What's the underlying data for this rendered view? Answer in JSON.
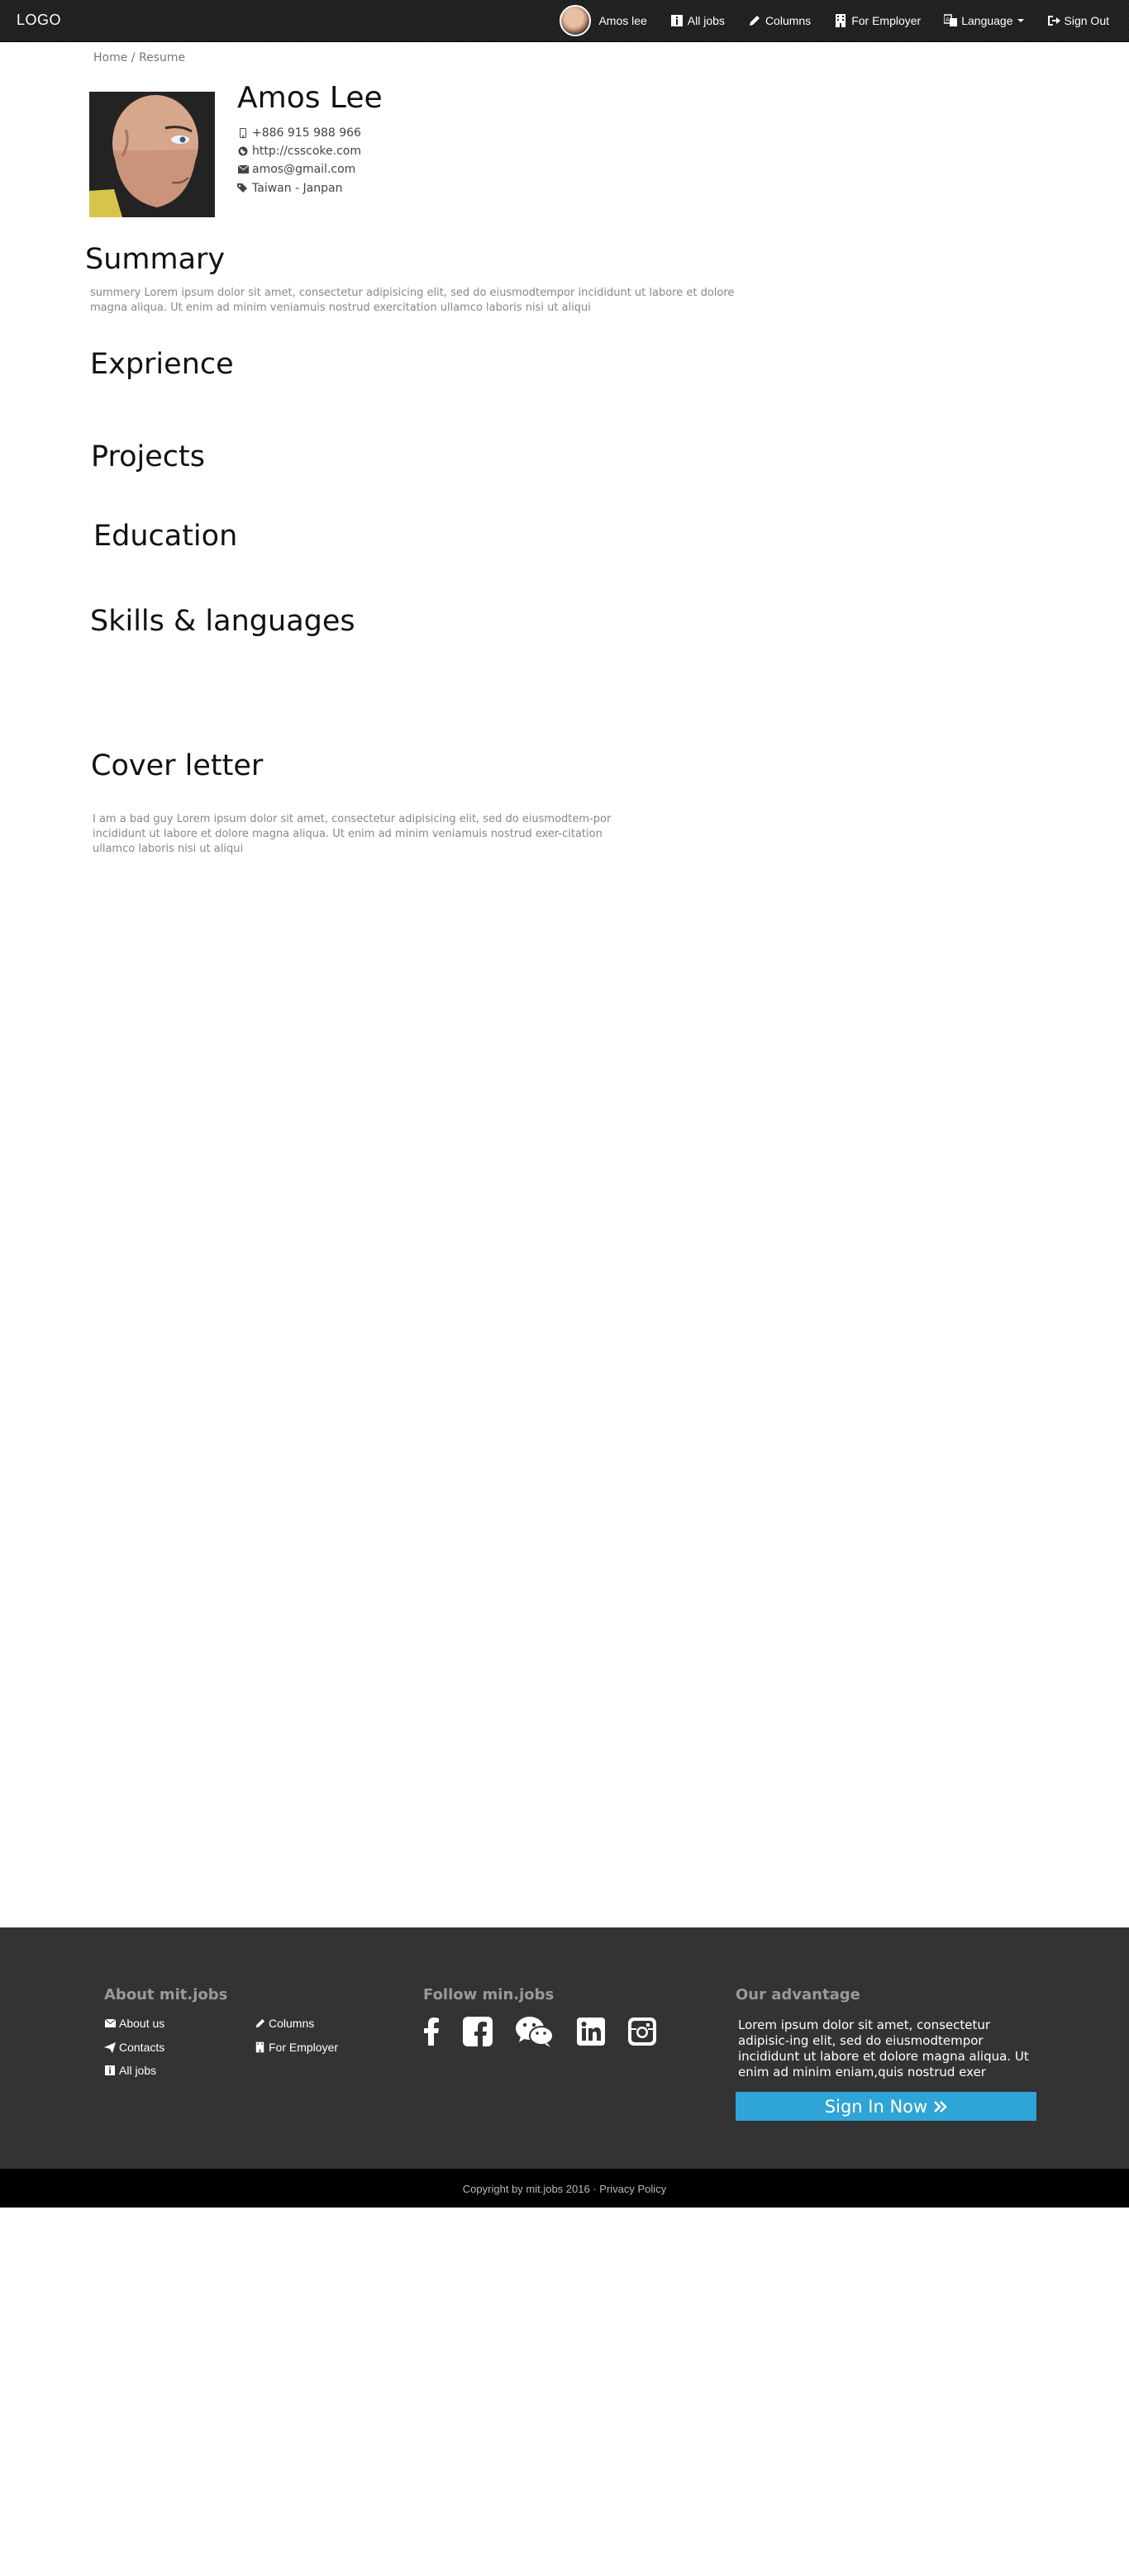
{
  "nav": {
    "logo": "LOGO",
    "user_name": "Amos lee",
    "all_jobs": "All jobs",
    "columns": "Columns",
    "for_employer": "For Employer",
    "language": "Language",
    "sign_out": "Sign Out"
  },
  "breadcrumb": {
    "home": "Home",
    "separator": " / ",
    "current": "Resume"
  },
  "profile": {
    "name": "Amos Lee",
    "phone": "+886 915 988 966",
    "website": "http://csscoke.com",
    "email": "amos@gmail.com",
    "location": "Taiwan - Janpan"
  },
  "sections": {
    "summary_title": "Summary",
    "summary_text": "summery   Lorem ipsum dolor sit amet, consectetur adipisicing elit, sed do eiusmodtempor incididunt ut labore et dolore magna aliqua. Ut enim ad minim veniamuis nostrud exercitation ullamco laboris nisi ut aliqui",
    "experience_title": "Exprience",
    "projects_title": "Projects",
    "education_title": "Education",
    "skills_title": "Skills & languages",
    "cover_title": "Cover letter",
    "cover_text": "I am a bad guy Lorem ipsum dolor sit amet, consectetur adipisicing elit, sed do eiusmodtem-por incididunt ut labore et dolore magna aliqua. Ut enim ad minim veniamuis nostrud exer-citation ullamco laboris nisi ut aliqui"
  },
  "footer": {
    "about_title": "About mit.jobs",
    "about_us": "About us",
    "columns": "Columns",
    "contacts": "Contacts",
    "for_employer": "For Employer",
    "all_jobs": "All jobs",
    "follow_title": "Follow min.jobs",
    "social_icons": [
      "facebook-icon",
      "facebook-square-icon",
      "wechat-icon",
      "linkedin-icon",
      "instagram-icon"
    ],
    "advantage_title": "Our advantage",
    "advantage_text": "Lorem ipsum dolor sit amet, consectetur adipisic-ing elit, sed do eiusmodtempor incididunt ut labore et dolore magna aliqua. Ut enim ad minim eniam,quis nostrud exer",
    "signin_label": "Sign In Now",
    "copyright": "Copyright by mit.jobs 2016",
    "privacy": "Privacy Policy"
  },
  "colors": {
    "navbar": "#1e1e1e",
    "footer": "#333333",
    "copyright_bar": "#000000",
    "accent": "#2fa4d6"
  }
}
